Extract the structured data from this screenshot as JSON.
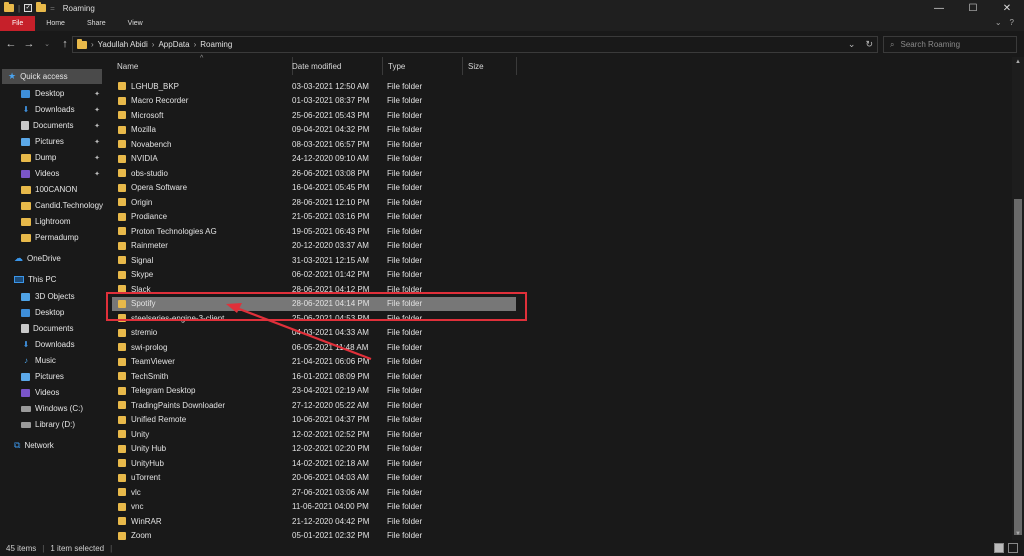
{
  "window": {
    "title": "Roaming",
    "controls": {
      "minimize": "—",
      "maximize": "☐",
      "close": "✕"
    }
  },
  "ribbon": {
    "tabs": [
      "File",
      "Home",
      "Share",
      "View"
    ],
    "expand_glyph": "⌄",
    "help_glyph": "?"
  },
  "address": {
    "crumbs": [
      "Yadullah Abidi",
      "AppData",
      "Roaming"
    ],
    "search_placeholder": "Search Roaming"
  },
  "nav": {
    "quick_access": "Quick access",
    "pinned": [
      "Desktop",
      "Downloads",
      "Documents",
      "Pictures",
      "Dump",
      "Videos"
    ],
    "folders": [
      "100CANON",
      "Candid.Technology",
      "Lightroom",
      "Permadump"
    ],
    "onedrive": "OneDrive",
    "this_pc": "This PC",
    "pc_items": [
      "3D Objects",
      "Desktop",
      "Documents",
      "Downloads",
      "Music",
      "Pictures",
      "Videos",
      "Windows (C:)",
      "Library (D:)"
    ],
    "network": "Network"
  },
  "columns": {
    "name": "Name",
    "date": "Date modified",
    "type": "Type",
    "size": "Size"
  },
  "files": [
    {
      "name": "LGHUB_BKP",
      "date": "03-03-2021 12:50 AM",
      "type": "File folder"
    },
    {
      "name": "Macro Recorder",
      "date": "01-03-2021 08:37 PM",
      "type": "File folder"
    },
    {
      "name": "Microsoft",
      "date": "25-06-2021 05:43 PM",
      "type": "File folder"
    },
    {
      "name": "Mozilla",
      "date": "09-04-2021 04:32 PM",
      "type": "File folder"
    },
    {
      "name": "Novabench",
      "date": "08-03-2021 06:57 PM",
      "type": "File folder"
    },
    {
      "name": "NVIDIA",
      "date": "24-12-2020 09:10 AM",
      "type": "File folder"
    },
    {
      "name": "obs-studio",
      "date": "26-06-2021 03:08 PM",
      "type": "File folder"
    },
    {
      "name": "Opera Software",
      "date": "16-04-2021 05:45 PM",
      "type": "File folder"
    },
    {
      "name": "Origin",
      "date": "28-06-2021 12:10 PM",
      "type": "File folder"
    },
    {
      "name": "Prodiance",
      "date": "21-05-2021 03:16 PM",
      "type": "File folder"
    },
    {
      "name": "Proton Technologies AG",
      "date": "19-05-2021 06:43 PM",
      "type": "File folder"
    },
    {
      "name": "Rainmeter",
      "date": "20-12-2020 03:37 AM",
      "type": "File folder"
    },
    {
      "name": "Signal",
      "date": "31-03-2021 12:15 AM",
      "type": "File folder"
    },
    {
      "name": "Skype",
      "date": "06-02-2021 01:42 PM",
      "type": "File folder"
    },
    {
      "name": "Slack",
      "date": "28-06-2021 04:12 PM",
      "type": "File folder"
    },
    {
      "name": "Spotify",
      "date": "28-06-2021 04:14 PM",
      "type": "File folder",
      "selected": true
    },
    {
      "name": "steelseries-engine-3-client",
      "date": "25-06-2021 04:53 PM",
      "type": "File folder"
    },
    {
      "name": "stremio",
      "date": "04-03-2021 04:33 AM",
      "type": "File folder"
    },
    {
      "name": "swi-prolog",
      "date": "06-05-2021 11:48 AM",
      "type": "File folder"
    },
    {
      "name": "TeamViewer",
      "date": "21-04-2021 06:06 PM",
      "type": "File folder"
    },
    {
      "name": "TechSmith",
      "date": "16-01-2021 08:09 PM",
      "type": "File folder"
    },
    {
      "name": "Telegram Desktop",
      "date": "23-04-2021 02:19 AM",
      "type": "File folder"
    },
    {
      "name": "TradingPaints Downloader",
      "date": "27-12-2020 05:22 AM",
      "type": "File folder"
    },
    {
      "name": "Unified Remote",
      "date": "10-06-2021 04:37 PM",
      "type": "File folder"
    },
    {
      "name": "Unity",
      "date": "12-02-2021 02:52 PM",
      "type": "File folder"
    },
    {
      "name": "Unity Hub",
      "date": "12-02-2021 02:20 PM",
      "type": "File folder"
    },
    {
      "name": "UnityHub",
      "date": "14-02-2021 02:18 AM",
      "type": "File folder"
    },
    {
      "name": "uTorrent",
      "date": "20-06-2021 04:03 AM",
      "type": "File folder"
    },
    {
      "name": "vlc",
      "date": "27-06-2021 03:06 AM",
      "type": "File folder"
    },
    {
      "name": "vnc",
      "date": "11-06-2021 04:00 PM",
      "type": "File folder"
    },
    {
      "name": "WinRAR",
      "date": "21-12-2020 04:42 PM",
      "type": "File folder"
    },
    {
      "name": "Zoom",
      "date": "05-01-2021 02:32 PM",
      "type": "File folder"
    }
  ],
  "status": {
    "items": "45 items",
    "selected": "1 item selected"
  },
  "colors": {
    "file_tab": "#c6202a",
    "folder": "#e8b94a",
    "annotation": "#e0303a",
    "selection": "#777777"
  }
}
